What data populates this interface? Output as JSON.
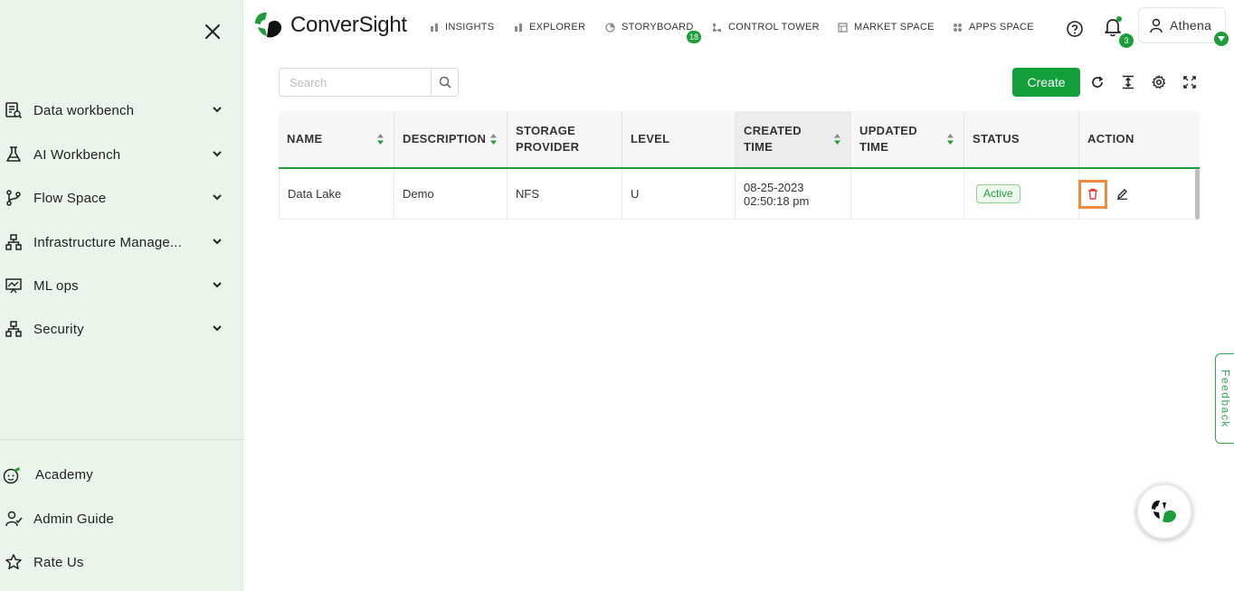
{
  "sidebar": {
    "items": [
      {
        "label": "Data workbench",
        "icon": "data-workbench-icon"
      },
      {
        "label": "AI Workbench",
        "icon": "flask-icon"
      },
      {
        "label": "Flow Space",
        "icon": "flow-icon"
      },
      {
        "label": "Infrastructure Manage...",
        "icon": "sitemap-icon"
      },
      {
        "label": "ML ops",
        "icon": "presentation-chart-icon"
      },
      {
        "label": "Security",
        "icon": "sitemap-icon"
      }
    ],
    "footer": [
      {
        "label": "Academy",
        "icon": "academy-icon"
      },
      {
        "label": "Admin Guide",
        "icon": "admin-guide-icon"
      },
      {
        "label": "Rate Us",
        "icon": "star-icon"
      }
    ]
  },
  "header": {
    "brand": "ConverSight",
    "menu": [
      {
        "label": "INSIGHTS"
      },
      {
        "label": "EXPLORER"
      },
      {
        "label": "STORYBOARD",
        "badge": "18"
      },
      {
        "label": "CONTROL TOWER"
      },
      {
        "label": "MARKET SPACE"
      },
      {
        "label": "APPS SPACE"
      }
    ],
    "notification_count": "3",
    "user_name": "Athena"
  },
  "toolbar": {
    "search_placeholder": "Search",
    "create_label": "Create"
  },
  "table": {
    "columns": [
      "NAME",
      "DESCRIPTION",
      "STORAGE PROVIDER",
      "LEVEL",
      "CREATED TIME",
      "UPDATED TIME",
      "STATUS",
      "ACTION"
    ],
    "rows": [
      {
        "name": "Data Lake",
        "description": "Demo",
        "storage_provider": "NFS",
        "level": "U",
        "created_date": "08-25-2023",
        "created_time": "02:50:18 pm",
        "updated_time": "",
        "status": "Active"
      }
    ]
  },
  "feedback_label": "Feedback",
  "colors": {
    "accent": "#13a03a",
    "sidebar_bg": "#eaf4ea",
    "highlight": "#f08a3c"
  }
}
